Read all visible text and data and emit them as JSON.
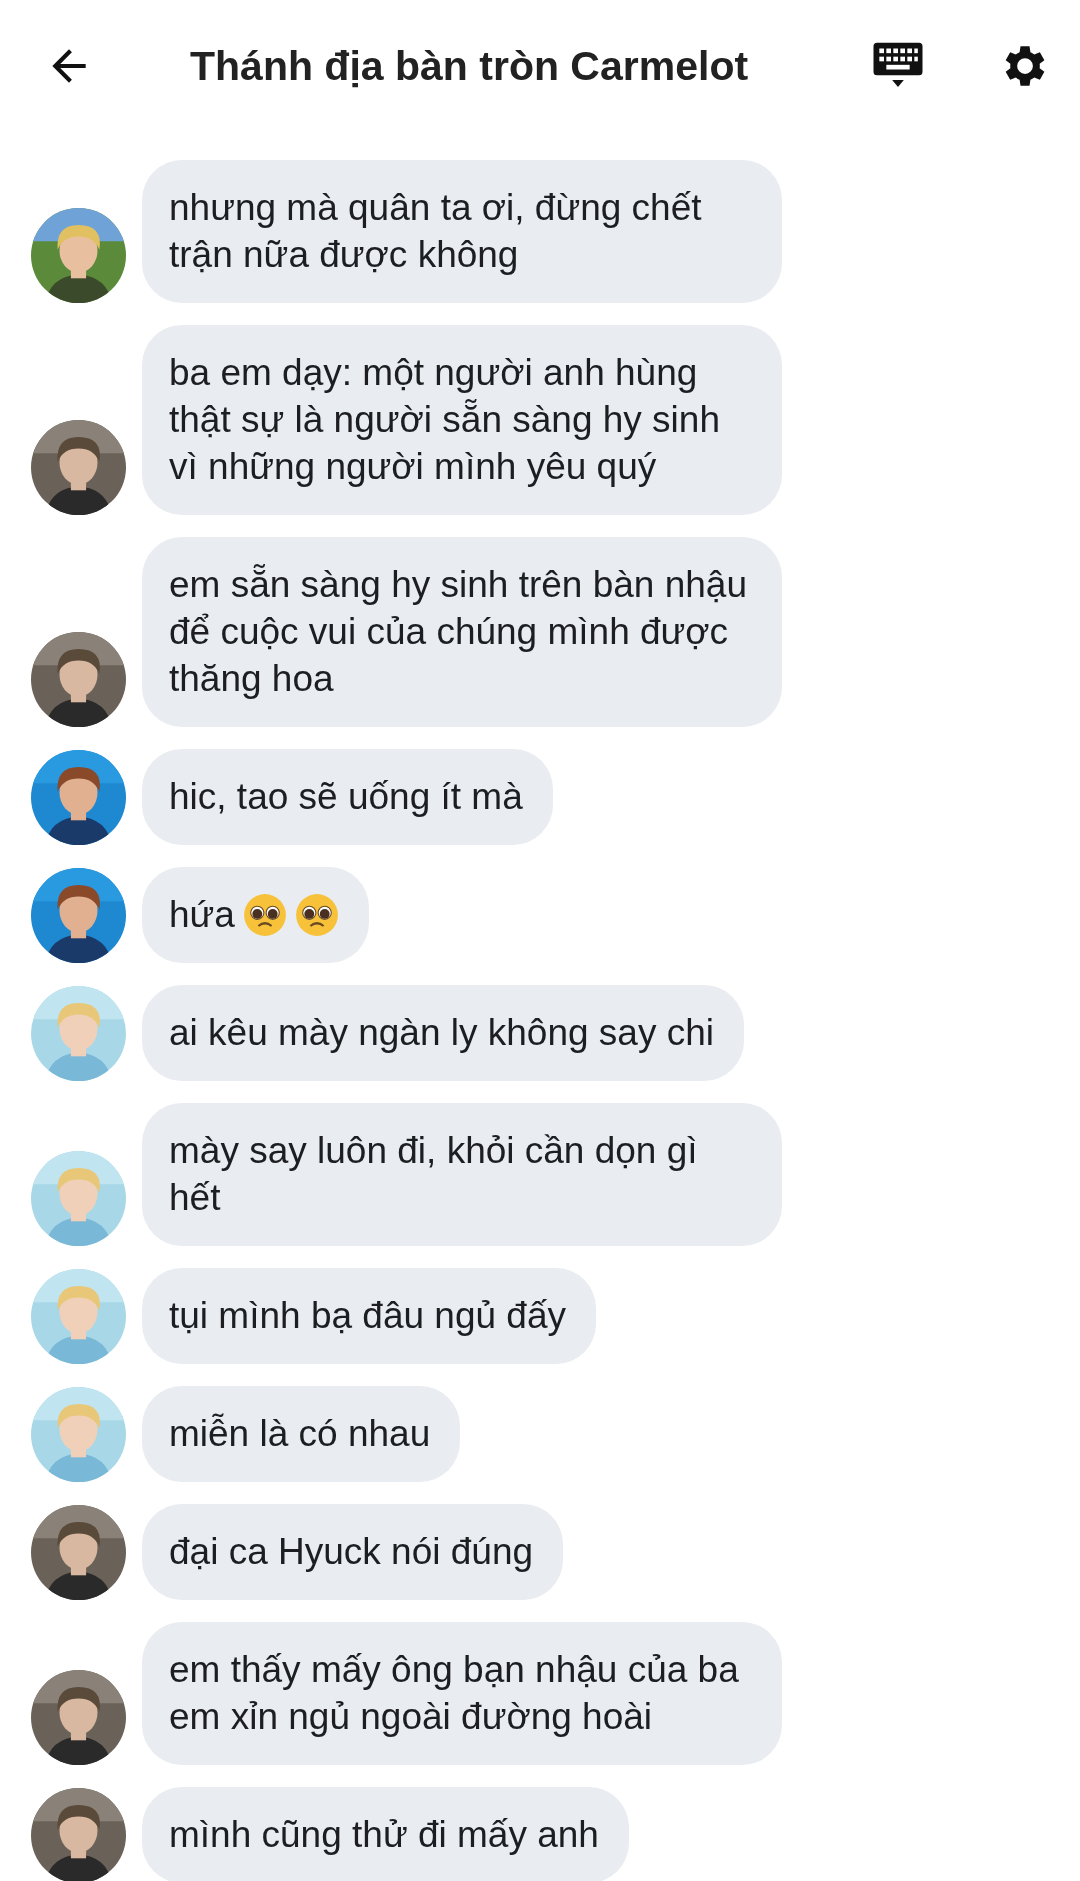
{
  "header": {
    "title": "Thánh địa bàn tròn Carmelot"
  },
  "messages": [
    {
      "text": "nhưng mà quân ta ơi, đừng chết trận nữa được không"
    },
    {
      "text": "ba em dạy: một người anh hùng thật sự là người sẵn sàng hy sinh vì những người mình yêu quý"
    },
    {
      "text": "em sẵn sàng hy sinh trên bàn nhậu để cuộc vui của chúng mình được thăng hoa"
    },
    {
      "text": "hic, tao sẽ uống ít mà"
    },
    {
      "text": "hứa",
      "trailing_icons": [
        {
          "kind": "pleading-face"
        },
        {
          "kind": "pleading-face"
        }
      ]
    },
    {
      "text": "ai kêu mày ngàn ly không say chi"
    },
    {
      "text": "mày say luôn đi, khỏi cần dọn gì hết"
    },
    {
      "text": "tụi mình bạ đâu ngủ đấy"
    },
    {
      "text": "miễn là có nhau"
    },
    {
      "text": "đại ca Hyuck nói đúng"
    },
    {
      "text": "em thấy mấy ông bạn nhậu của ba em xỉn ngủ ngoài đường hoài"
    },
    {
      "text": "mình cũng thử đi mấy anh"
    }
  ]
}
